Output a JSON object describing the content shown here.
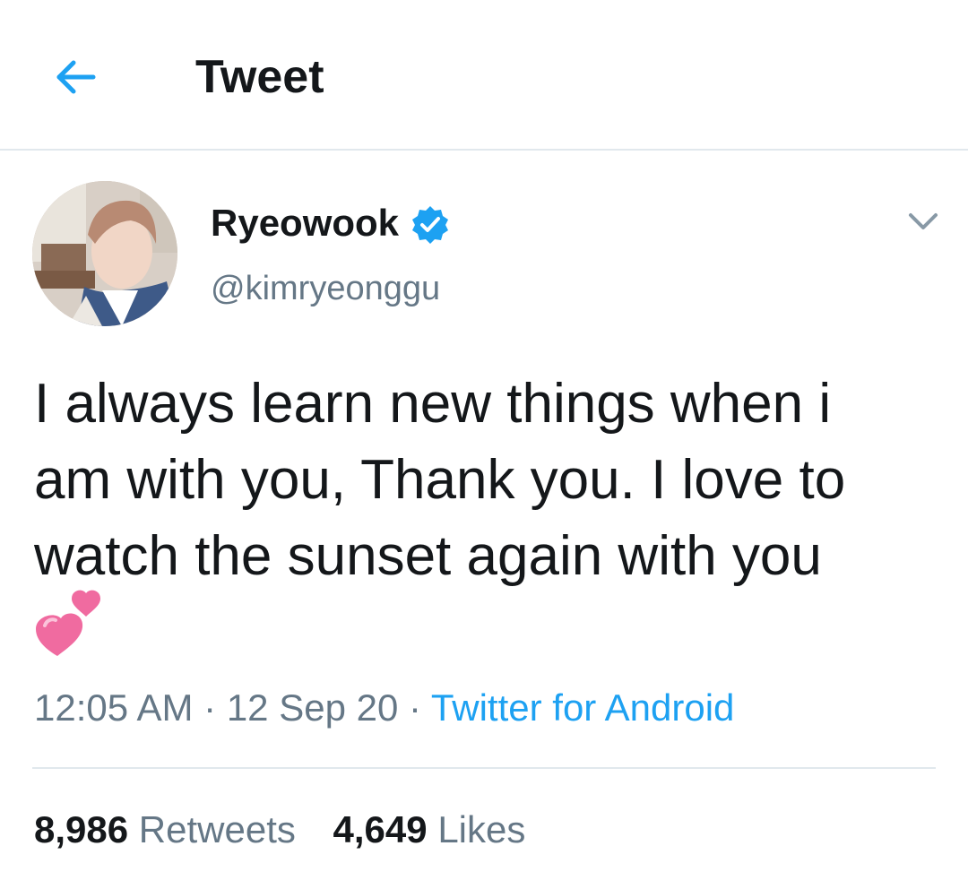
{
  "header": {
    "title": "Tweet",
    "back_icon": "arrow-left-icon"
  },
  "user": {
    "display_name": "Ryeowook",
    "handle": "@kimryeonggu",
    "verified": true,
    "verified_icon": "verified-badge-icon",
    "menu_icon": "chevron-down-icon"
  },
  "tweet": {
    "lines": [
      "I always learn new things when i",
      "am with you, Thank you. I love to",
      "watch the sunset again with you"
    ],
    "emoji": "two-hearts-icon",
    "time": "12:05 AM",
    "separator": "·",
    "date": "12 Sep 20",
    "source": "Twitter for Android"
  },
  "stats": {
    "retweets_count": "8,986",
    "retweets_label": "Retweets",
    "likes_count": "4,649",
    "likes_label": "Likes"
  },
  "colors": {
    "accent": "#1da1f2",
    "text_primary": "#14171a",
    "text_secondary": "#657786",
    "divider": "#e1e8ed",
    "emoji_pink": "#f06ba0"
  }
}
